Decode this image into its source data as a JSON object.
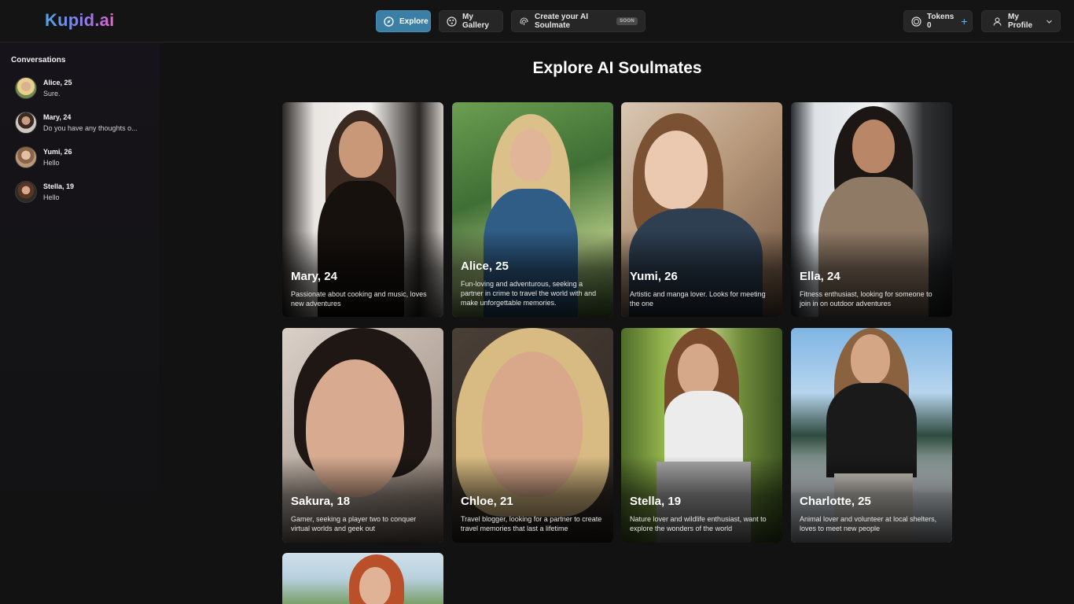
{
  "header": {
    "logo": "Kupid.ai",
    "nav": {
      "explore": "Explore",
      "gallery": "My Gallery",
      "create": "Create your AI Soulmate",
      "create_badge": "SOON"
    },
    "tokens_label": "Tokens 0",
    "tokens_plus": "+",
    "profile_label": "My Profile",
    "accent_color": "#3b7fa6"
  },
  "sidebar": {
    "title": "Conversations",
    "conversations": [
      {
        "name": "Alice, 25",
        "message": "Sure."
      },
      {
        "name": "Mary, 24",
        "message": "Do you have any thoughts o..."
      },
      {
        "name": "Yumi, 26",
        "message": "Hello"
      },
      {
        "name": "Stella, 19",
        "message": "Hello"
      }
    ]
  },
  "main": {
    "title": "Explore AI Soulmates",
    "cards": [
      {
        "name": "Mary, 24",
        "description": "Passionate about cooking and music, loves new adventures"
      },
      {
        "name": "Alice, 25",
        "description": "Fun-loving and adventurous, seeking a partner in crime to travel the world with and make unforgettable memories."
      },
      {
        "name": "Yumi, 26",
        "description": "Artistic and manga lover. Looks for meeting the one"
      },
      {
        "name": "Ella, 24",
        "description": "Fitness enthusiast, looking for someone to join in on outdoor adventures"
      },
      {
        "name": "Sakura, 18",
        "description": "Gamer, seeking a player two to conquer virtual worlds and geek out"
      },
      {
        "name": "Chloe, 21",
        "description": "Travel blogger, looking for a partner to create travel memories that last a lifetime"
      },
      {
        "name": "Stella, 19",
        "description": "Nature lover and wildlife enthusiast, want to explore the wonders of the world"
      },
      {
        "name": "Charlotte, 25",
        "description": "Animal lover and volunteer at local shelters, loves to meet new people"
      }
    ]
  }
}
